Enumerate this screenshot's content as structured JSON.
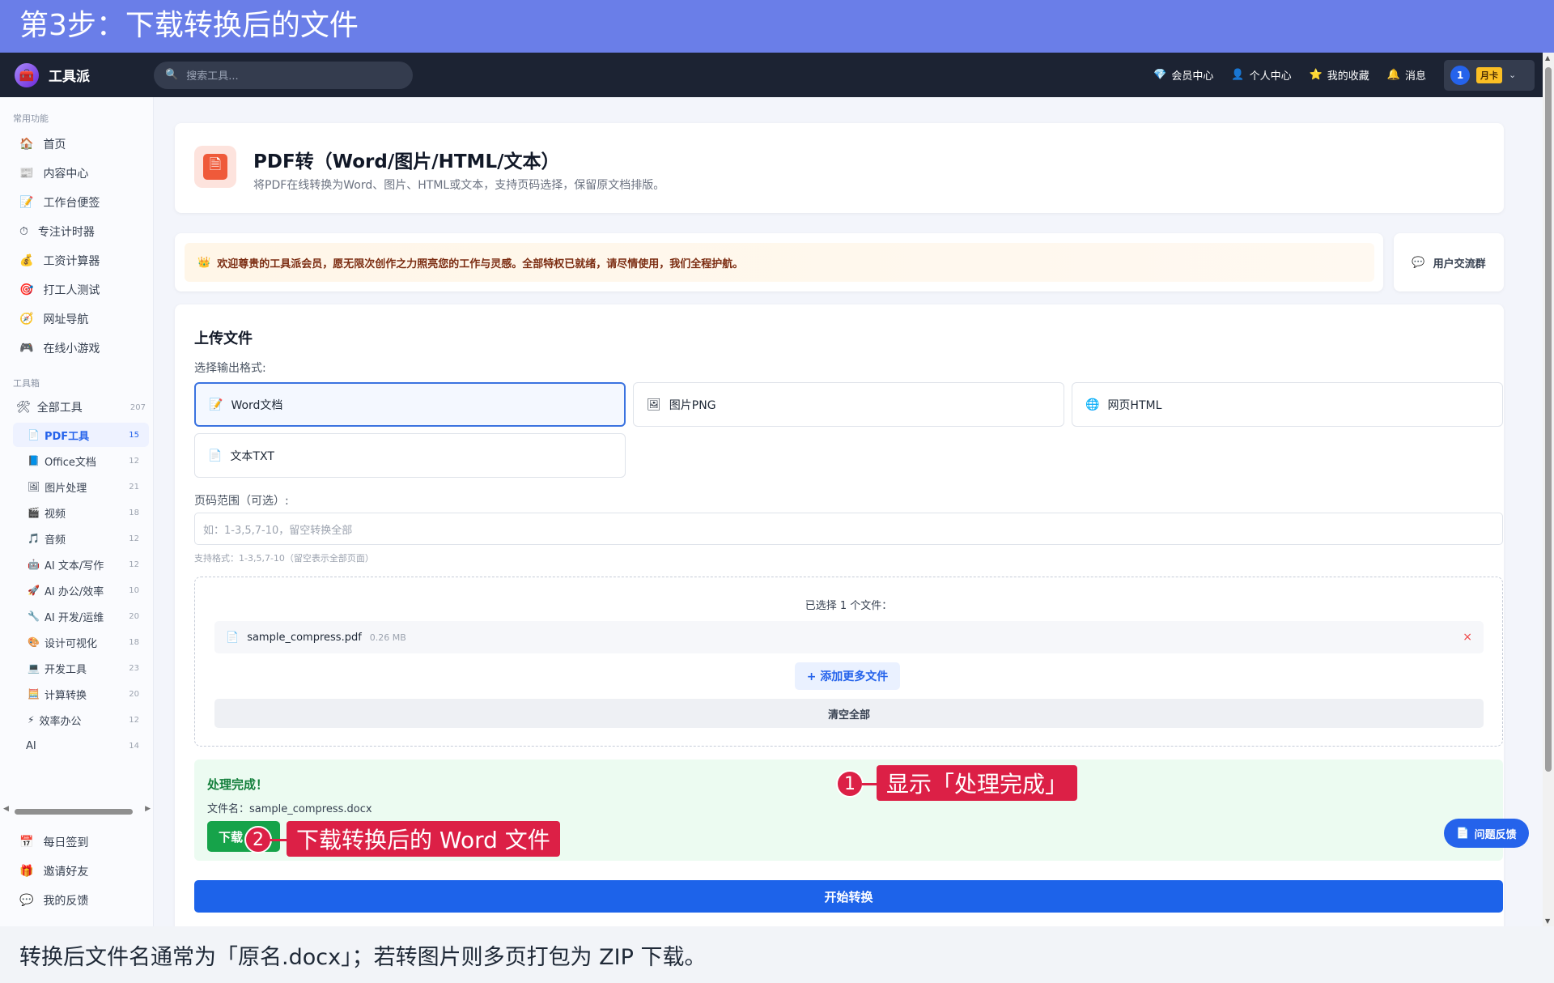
{
  "banner": {
    "text": "第3步：下载转换后的文件"
  },
  "topbar": {
    "logo_text": "工具派",
    "search_placeholder": "搜索工具...",
    "nav": [
      {
        "icon": "💎",
        "label": "会员中心"
      },
      {
        "icon": "👤",
        "label": "个人中心"
      },
      {
        "icon": "⭐",
        "label": "我的收藏"
      },
      {
        "icon": "🔔",
        "label": "消息"
      }
    ],
    "user": {
      "avatar": "1",
      "tag": "月卡"
    }
  },
  "sidebar": {
    "common_title": "常用功能",
    "common": [
      {
        "icon": "🏠",
        "label": "首页"
      },
      {
        "icon": "📰",
        "label": "内容中心"
      },
      {
        "icon": "📝",
        "label": "工作台便签"
      },
      {
        "icon": "⏱",
        "label": "专注计时器"
      },
      {
        "icon": "💰",
        "label": "工资计算器"
      },
      {
        "icon": "🎯",
        "label": "打工人测试"
      },
      {
        "icon": "🧭",
        "label": "网址导航"
      },
      {
        "icon": "🎮",
        "label": "在线小游戏"
      }
    ],
    "toolbox_title": "工具箱",
    "all_tools": {
      "icon": "🛠",
      "label": "全部工具",
      "count": "207"
    },
    "categories": [
      {
        "icon": "📄",
        "label": "PDF工具",
        "count": "15",
        "active": true
      },
      {
        "icon": "📘",
        "label": "Office文档",
        "count": "12"
      },
      {
        "icon": "🖼",
        "label": "图片处理",
        "count": "21"
      },
      {
        "icon": "🎬",
        "label": "视频",
        "count": "18"
      },
      {
        "icon": "🎵",
        "label": "音频",
        "count": "12"
      },
      {
        "icon": "🤖",
        "label": "AI 文本/写作",
        "count": "12"
      },
      {
        "icon": "🚀",
        "label": "AI 办公/效率",
        "count": "10"
      },
      {
        "icon": "🔧",
        "label": "AI 开发/运维",
        "count": "20"
      },
      {
        "icon": "🎨",
        "label": "设计可视化",
        "count": "18"
      },
      {
        "icon": "💻",
        "label": "开发工具",
        "count": "23"
      },
      {
        "icon": "🧮",
        "label": "计算转换",
        "count": "20"
      },
      {
        "icon": "⚡",
        "label": "效率办公",
        "count": "12"
      },
      {
        "icon": "",
        "label": "AI",
        "count": "14"
      }
    ],
    "bottom": [
      {
        "icon": "📅",
        "label": "每日签到"
      },
      {
        "icon": "🎁",
        "label": "邀请好友"
      },
      {
        "icon": "💬",
        "label": "我的反馈"
      }
    ]
  },
  "header": {
    "title": "PDF转（Word/图片/HTML/文本）",
    "subtitle": "将PDF在线转换为Word、图片、HTML或文本，支持页码选择，保留原文档排版。"
  },
  "notice": {
    "icon": "👑",
    "text": "欢迎尊贵的工具派会员，愿无限次创作之力照亮您的工作与灵感。全部特权已就绪，请尽情使用，我们全程护航。"
  },
  "group_button": {
    "icon": "💬",
    "label": "用户交流群"
  },
  "upload": {
    "title": "上传文件",
    "format_label": "选择输出格式:",
    "formats": [
      {
        "icon": "📝",
        "label": "Word文档",
        "selected": true
      },
      {
        "icon": "🖼",
        "label": "图片PNG"
      },
      {
        "icon": "🌐",
        "label": "网页HTML"
      },
      {
        "icon": "📄",
        "label": "文本TXT"
      }
    ],
    "page_label": "页码范围（可选）:",
    "page_placeholder": "如：1-3,5,7-10，留空转换全部",
    "page_hint": "支持格式：1-3,5,7-10（留空表示全部页面）",
    "selected_text": "已选择 1 个文件：",
    "file": {
      "icon": "📄",
      "name": "sample_compress.pdf",
      "size": "0.26 MB",
      "remove": "×"
    },
    "add_more": "+ 添加更多文件",
    "clear_all": "清空全部"
  },
  "result": {
    "title": "处理完成！",
    "filename": "文件名：sample_compress.docx",
    "download_label": "下载"
  },
  "start_button": "开始转换",
  "callouts": [
    {
      "num": "1",
      "text": "显示「处理完成」"
    },
    {
      "num": "2",
      "text": "下载转换后的 Word 文件"
    }
  ],
  "feedback": {
    "icon": "📄",
    "label": "问题反馈"
  },
  "footer": {
    "text": "转换后文件名通常为「原名.docx」；若转图片则多页打包为 ZIP 下载。"
  }
}
